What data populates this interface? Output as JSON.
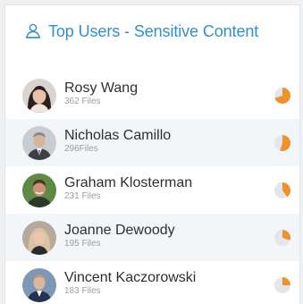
{
  "widget": {
    "title": "Top Users - Sensitive Content",
    "icon": "users-icon",
    "accent_color": "#2f8fd0",
    "pie_color": "#f0922b",
    "pie_track_color": "#e4e6e9"
  },
  "users": [
    {
      "name": "Rosy Wang",
      "files": "362 Files",
      "share": 0.7,
      "avatar_color": "#3a2f2c"
    },
    {
      "name": "Nicholas Camillo",
      "files": "296Files",
      "share": 0.55,
      "avatar_color": "#6d6a67"
    },
    {
      "name": "Graham Klosterman",
      "files": "231 Files",
      "share": 0.4,
      "avatar_color": "#4a7a3a"
    },
    {
      "name": "Joanne Dewoody",
      "files": "195 Files",
      "share": 0.3,
      "avatar_color": "#c2a88f"
    },
    {
      "name": "Vincent Kaczorowski",
      "files": "183 Files",
      "share": 0.25,
      "avatar_color": "#2d4a6b"
    }
  ]
}
